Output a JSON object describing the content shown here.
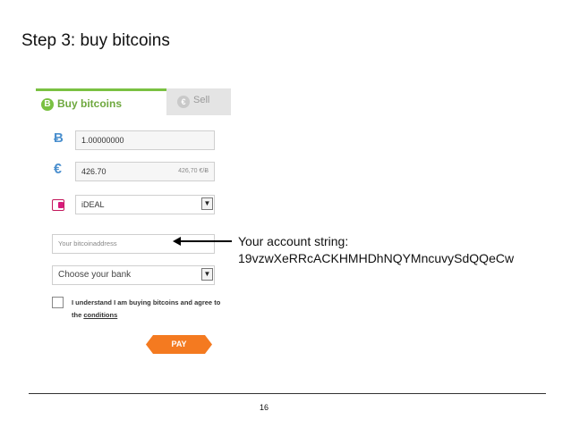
{
  "slide": {
    "title": "Step 3: buy bitcoins",
    "page_number": "16"
  },
  "widget": {
    "tabs": [
      {
        "label": "Buy bitcoins",
        "icon": "bitcoin-icon",
        "active": true
      },
      {
        "label": "Sell",
        "icon": "euro-coin-icon",
        "active": false
      }
    ],
    "bitcoin_row": {
      "icon": "Ƀ",
      "value": "1.00000000"
    },
    "euro_row": {
      "icon": "€",
      "value": "426.70",
      "rate": "426,70 €/Ƀ"
    },
    "payment_method": {
      "icon": "ideal-icon",
      "selected": "iDEAL"
    },
    "address_field": {
      "placeholder": "Your bitcoinaddress"
    },
    "bank_select": {
      "selected": "Choose your bank"
    },
    "consent": {
      "text": "I understand I am buying bitcoins and agree to the",
      "link": "conditions"
    },
    "pay_button": "PAY",
    "colors": {
      "accent_green": "#7ac142",
      "pay_orange": "#f47a20",
      "icon_blue": "#4a8fce"
    }
  },
  "annotation": {
    "line1": "Your account string:",
    "line2": "19vzwXeRRcACKHMHDhNQYMncuvySdQQeCw"
  }
}
